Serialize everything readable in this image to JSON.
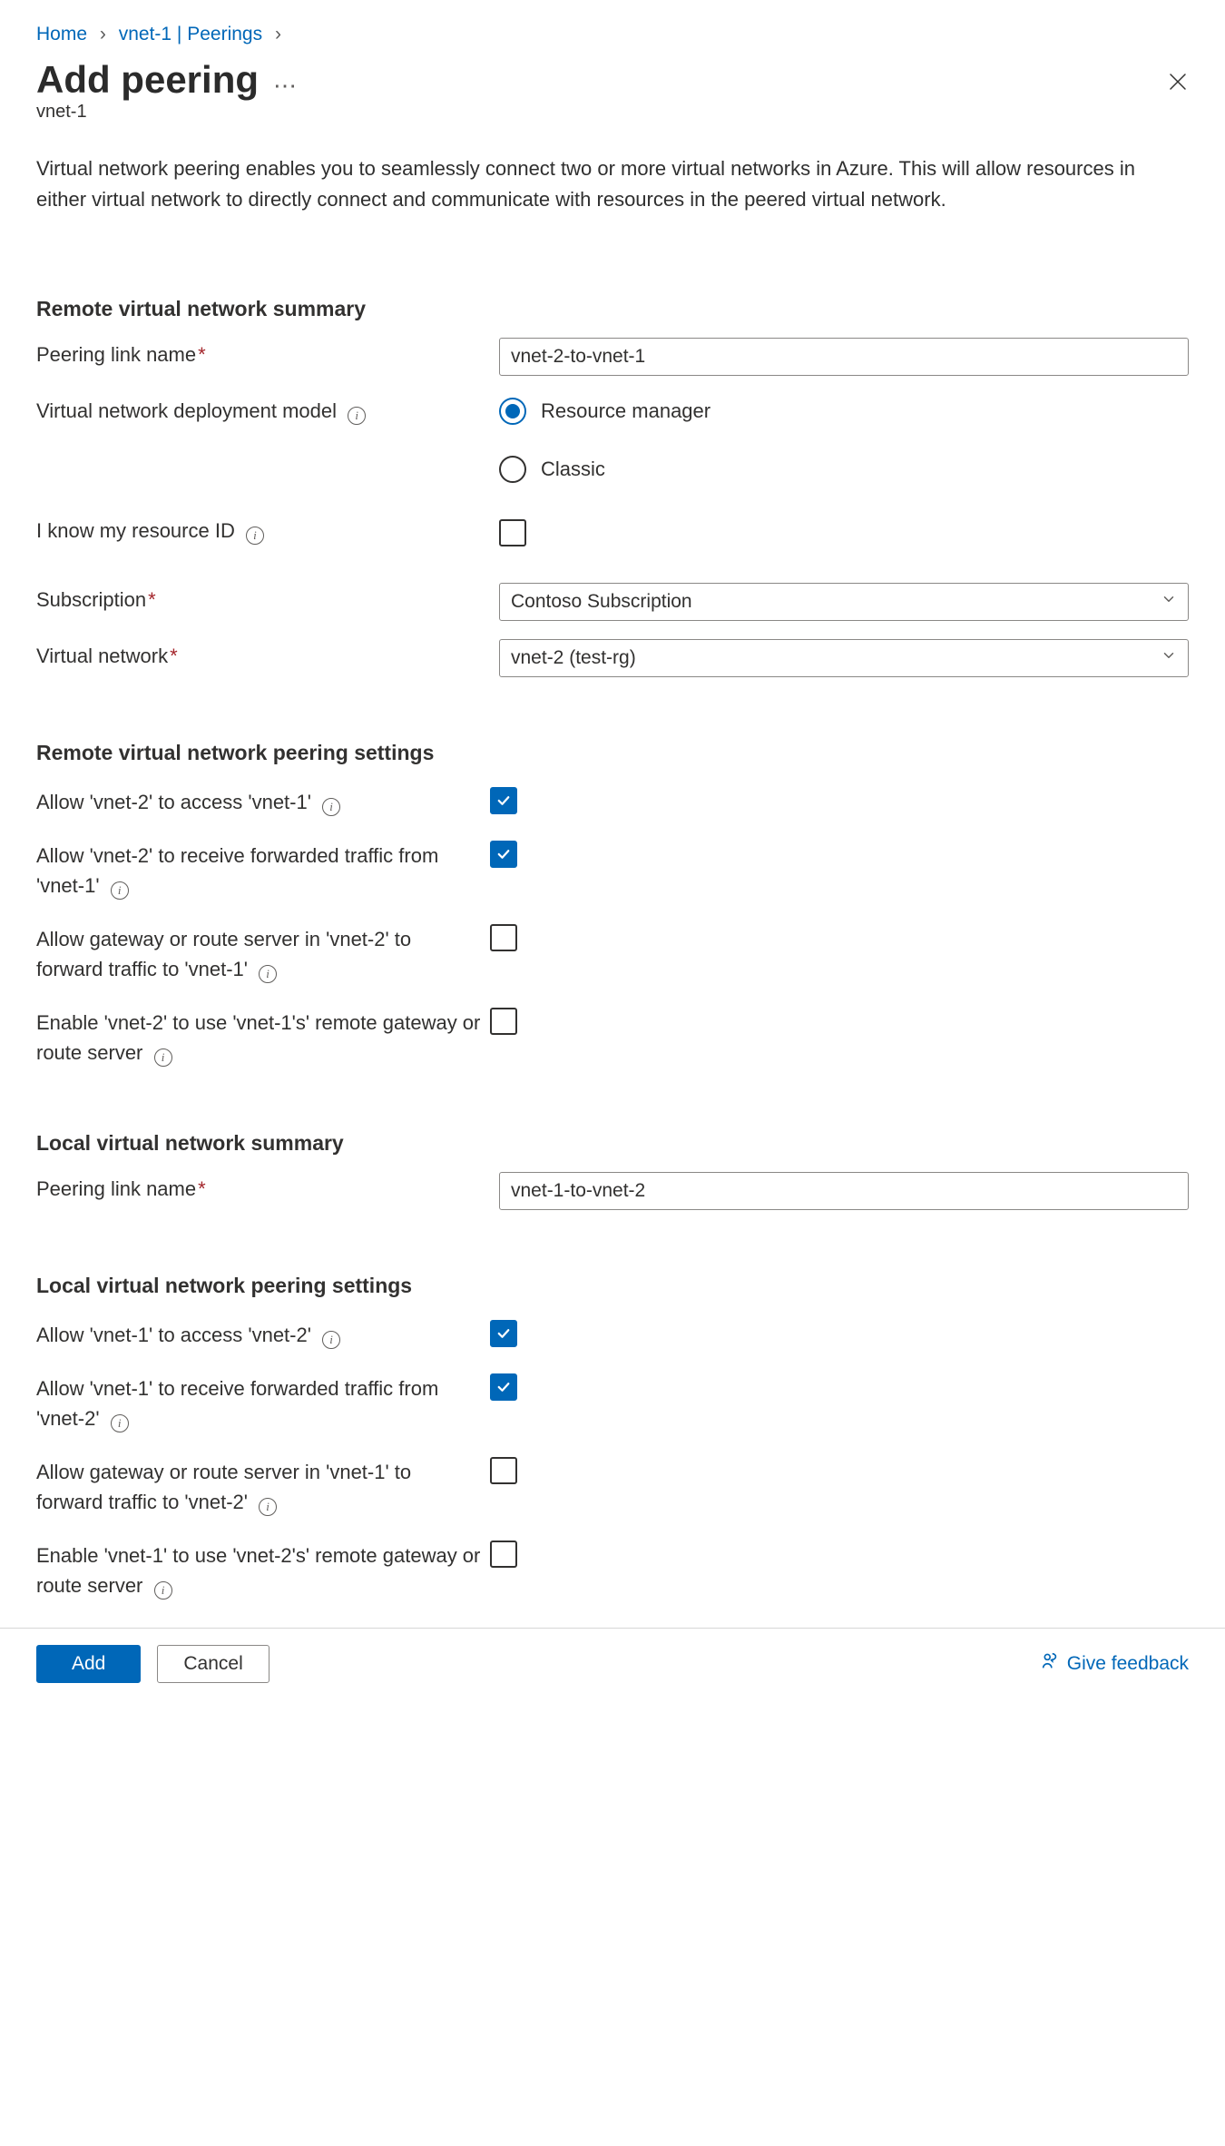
{
  "breadcrumbs": {
    "home": "Home",
    "current": "vnet-1 | Peerings"
  },
  "header": {
    "title": "Add peering",
    "subtitle": "vnet-1"
  },
  "intro": "Virtual network peering enables you to seamlessly connect two or more virtual networks in Azure. This will allow resources in either virtual network to directly connect and communicate with resources in the peered virtual network.",
  "sections": {
    "remote_summary": {
      "heading": "Remote virtual network summary",
      "peering_link_label": "Peering link name",
      "peering_link_value": "vnet-2-to-vnet-1",
      "deployment_model_label": "Virtual network deployment model",
      "deployment_options": {
        "resource_manager": "Resource manager",
        "classic": "Classic"
      },
      "know_resource_id_label": "I know my resource ID",
      "subscription_label": "Subscription",
      "subscription_value": "Contoso Subscription",
      "virtual_network_label": "Virtual network",
      "virtual_network_value": "vnet-2 (test-rg)"
    },
    "remote_settings": {
      "heading": "Remote virtual network peering settings",
      "allow_access": "Allow 'vnet-2' to access 'vnet-1'",
      "allow_forwarded": "Allow 'vnet-2' to receive forwarded traffic from 'vnet-1'",
      "allow_gateway": "Allow gateway or route server in 'vnet-2' to forward traffic to 'vnet-1'",
      "enable_remote_gateway": "Enable 'vnet-2' to use 'vnet-1's' remote gateway or route server"
    },
    "local_summary": {
      "heading": "Local virtual network summary",
      "peering_link_label": "Peering link name",
      "peering_link_value": "vnet-1-to-vnet-2"
    },
    "local_settings": {
      "heading": "Local virtual network peering settings",
      "allow_access": "Allow 'vnet-1' to access 'vnet-2'",
      "allow_forwarded": "Allow 'vnet-1' to receive forwarded traffic from 'vnet-2'",
      "allow_gateway": "Allow gateway or route server in 'vnet-1' to forward traffic to 'vnet-2'",
      "enable_remote_gateway": "Enable 'vnet-1' to use 'vnet-2's' remote gateway or route server"
    }
  },
  "footer": {
    "add": "Add",
    "cancel": "Cancel",
    "feedback": "Give feedback"
  }
}
